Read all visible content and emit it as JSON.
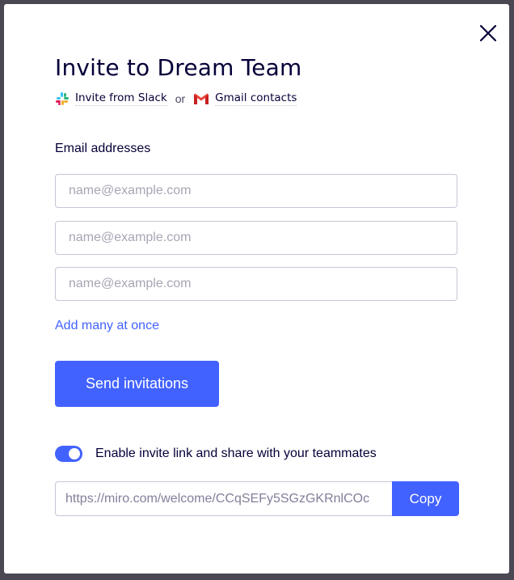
{
  "dialog": {
    "title": "Invite to Dream Team",
    "close_icon": "close-icon"
  },
  "imports": {
    "slack": {
      "label": "Invite from Slack",
      "icon": "slack-icon"
    },
    "separator": "or",
    "gmail": {
      "label": "Gmail contacts",
      "icon": "gmail-icon"
    }
  },
  "emails": {
    "label": "Email addresses",
    "fields": [
      {
        "value": "",
        "placeholder": "name@example.com"
      },
      {
        "value": "",
        "placeholder": "name@example.com"
      },
      {
        "value": "",
        "placeholder": "name@example.com"
      }
    ],
    "add_many_label": "Add many at once"
  },
  "send_button": {
    "label": "Send invitations"
  },
  "invite_link": {
    "toggle_enabled": true,
    "toggle_label": "Enable invite link and share with your teammates",
    "url": "https://miro.com/welcome/CCqSEFy5SGzGKRnlCOc",
    "copy_label": "Copy"
  },
  "colors": {
    "accent": "#4262ff",
    "text": "#050038",
    "backdrop": "#4b4853",
    "slack_green": "#2eb67d",
    "slack_blue": "#36c5f0",
    "slack_yellow": "#ecb22e",
    "slack_red": "#e01e5a",
    "gmail_red": "#ea4335"
  }
}
